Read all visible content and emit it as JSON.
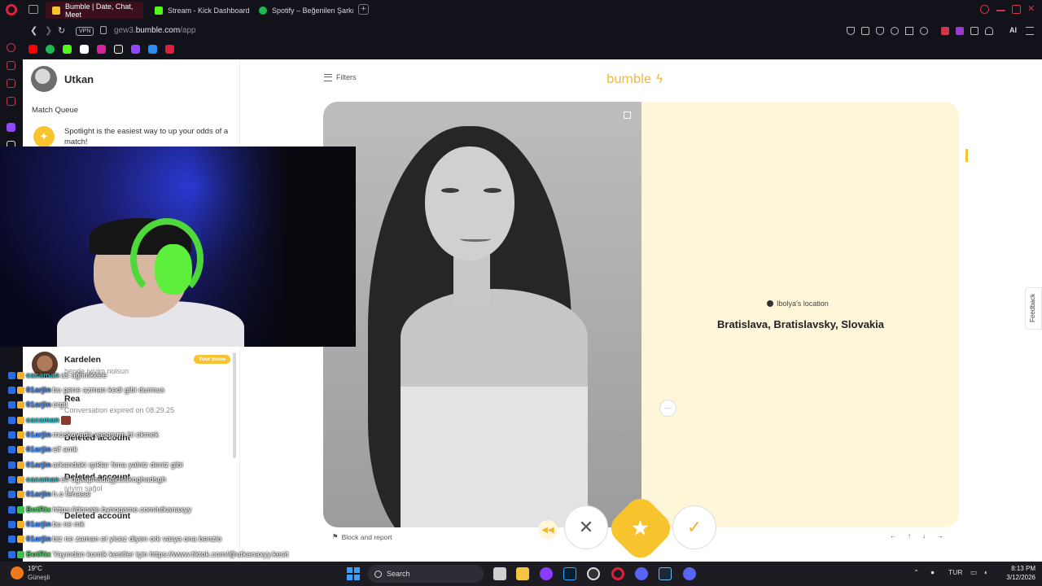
{
  "browser": {
    "tabs": [
      {
        "label": "Bumble | Date, Chat, Meet",
        "active": true,
        "color": "#f8c42d"
      },
      {
        "label": "Stream - Kick Dashboard",
        "active": false,
        "color": "#53fc18"
      },
      {
        "label": "Spotify – Beğenilen Şarkıla",
        "active": false,
        "color": "#1db954"
      }
    ],
    "vpn_label": "VPN",
    "url_prefix": "gew3.",
    "url_domain": "bumble.com",
    "url_path": "/app",
    "ai_label": "AI"
  },
  "bookmarks": [
    "youtube-icon",
    "spotify-icon",
    "kick-icon",
    "x-icon",
    "instagram-icon",
    "tiktok-icon",
    "twitch-icon",
    "discord-icon",
    "red-app-icon"
  ],
  "app": {
    "profile_name": "Utkan",
    "match_queue_title": "Match Queue",
    "spotlight_text": "Spotlight is the easiest way to up your odds of a match!",
    "conversations": [
      {
        "name": "Kardelen",
        "subtitle": "bende iyiyim nolsun",
        "badge": "Your move"
      },
      {
        "name": "Rea",
        "subtitle": "Conversation expired on 08.29.25"
      },
      {
        "name": "Deleted account",
        "subtitle": ""
      },
      {
        "name": "Deleted account",
        "subtitle": "iyiyim sağol"
      },
      {
        "name": "Deleted account",
        "subtitle": ""
      }
    ],
    "filters_label": "Filters",
    "logo": "bumble",
    "profile_card": {
      "location_label": "Ibolya's location",
      "location_value": "Bratislava, Bratislavsky, Slovakia"
    },
    "block_report": "Block and report",
    "actions": {
      "rewind": "rewind",
      "pass": "✕",
      "superswipe": "★",
      "like": "✓"
    },
    "kbd_hints": [
      "←",
      "↑",
      "↓",
      "→"
    ],
    "feedback_label": "Feedback"
  },
  "chat": [
    {
      "user": "cacaman",
      "color": "cyan",
      "text": "as ağlımkeee"
    },
    {
      "user": "01arjin",
      "color": "blue",
      "text": "bu gene azman kedi gibi durmus"
    },
    {
      "user": "01arjin",
      "color": "blue",
      "text": "ergil"
    },
    {
      "user": "cacaman",
      "color": "cyan",
      "text": ""
    },
    {
      "user": "01arjin",
      "color": "blue",
      "text": "moskovada yasaşırm bi ekmek"
    },
    {
      "user": "01arjin",
      "color": "blue",
      "text": "elf amk"
    },
    {
      "user": "01arjin",
      "color": "blue",
      "text": "arkandaki ışıklar fena yalniz deniz gibi"
    },
    {
      "user": "cacaman",
      "color": "cyan",
      "text": "elf dgaaphadagjdsakoghadsgh"
    },
    {
      "user": "01arjin",
      "color": "blue",
      "text": "h.o fenasal"
    },
    {
      "user": "BotRix",
      "color": "green",
      "text": "https://donate.bynogame.com/utkanaxyy"
    },
    {
      "user": "01arjin",
      "color": "blue",
      "text": "bu ne mk"
    },
    {
      "user": "01arjin",
      "color": "blue",
      "text": "biz ne zaman et yicez diyen ork varya ona benzio"
    },
    {
      "user": "BotRix",
      "color": "green",
      "text": "Yayından komik kesitler için https://www.tiktok.com/@utkanaxyy.kesit"
    }
  ],
  "taskbar": {
    "temperature": "19°C",
    "weather": "Güneşli",
    "search_label": "Search",
    "language": "TUR",
    "time": "8:13 PM",
    "date": "3/12/2026",
    "apps": [
      "widgets-icon",
      "task-view-icon",
      "file-explorer-icon",
      "opera-gx-icon",
      "photoshop-icon",
      "chrome-icon",
      "opera-icon",
      "discord-icon",
      "steam-icon",
      "discord-alt-icon"
    ]
  }
}
